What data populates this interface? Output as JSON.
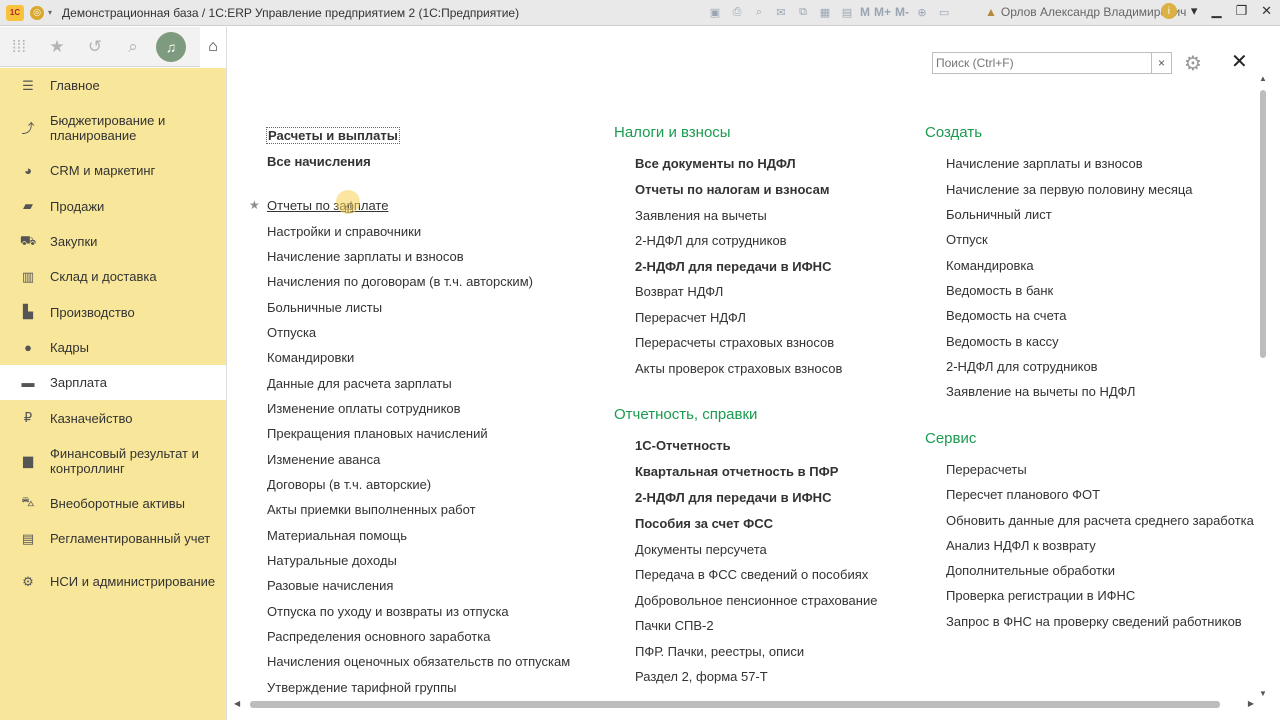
{
  "window": {
    "title": "Демонстрационная база / 1С:ERP Управление предприятием 2  (1С:Предприятие)",
    "app_logo": "1С",
    "user_name": "Орлов Александр Владимирович",
    "toolbar_icons": [
      "save-icon",
      "print-icon",
      "find-icon",
      "mail-icon",
      "link-icon",
      "calendar-icon"
    ],
    "m_label": "M",
    "m_plus_label": "M+",
    "m_minus_label": "M-"
  },
  "quickbar": {
    "icons": [
      "apps-grid-icon",
      "favorites-star-icon",
      "history-icon",
      "search-icon",
      "notifications-bell-icon",
      "home-icon"
    ]
  },
  "sidebar": {
    "items": [
      {
        "label": "Главное",
        "icon": "menu-icon"
      },
      {
        "label": "Бюджетирование и планирование",
        "icon": "chart-icon"
      },
      {
        "label": "CRM и маркетинг",
        "icon": "pie-icon"
      },
      {
        "label": "Продажи",
        "icon": "bag-icon"
      },
      {
        "label": "Закупки",
        "icon": "cart-icon"
      },
      {
        "label": "Склад и доставка",
        "icon": "warehouse-icon"
      },
      {
        "label": "Производство",
        "icon": "factory-icon"
      },
      {
        "label": "Кадры",
        "icon": "person-icon"
      },
      {
        "label": "Зарплата",
        "icon": "card-icon"
      },
      {
        "label": "Казначейство",
        "icon": "ruble-icon"
      },
      {
        "label": "Финансовый результат и контроллинг",
        "icon": "bars-icon"
      },
      {
        "label": "Внеоборотные активы",
        "icon": "truck-icon"
      },
      {
        "label": "Регламентированный учет",
        "icon": "ledger-icon"
      },
      {
        "label": "НСИ и администрирование",
        "icon": "gear-icon"
      }
    ],
    "active_index": 8
  },
  "search": {
    "placeholder": "Поиск (Ctrl+F)",
    "clear": "×"
  },
  "col1": {
    "top_links": [
      "Расчеты и выплаты",
      "Все начисления"
    ],
    "links": [
      "Отчеты по зарплате",
      "Настройки и справочники",
      "Начисление зарплаты и взносов",
      "Начисления по договорам (в т.ч. авторским)",
      "Больничные листы",
      "Отпуска",
      "Командировки",
      "Данные для расчета зарплаты",
      "Изменение оплаты сотрудников",
      "Прекращения плановых начислений",
      "Изменение аванса",
      "Договоры (в т.ч. авторские)",
      "Акты приемки выполненных работ",
      "Материальная помощь",
      "Натуральные доходы",
      "Разовые начисления",
      "Отпуска по уходу и возвраты из отпуска",
      "Распределения основного заработка",
      "Начисления оценочных обязательств по отпускам",
      "Утверждение тарифной группы"
    ]
  },
  "col2": {
    "section1_title": "Налоги и взносы",
    "section1_links": [
      {
        "label": "Все документы по НДФЛ",
        "bold": true
      },
      {
        "label": "Отчеты по налогам и взносам",
        "bold": true
      },
      {
        "label": "Заявления на вычеты",
        "bold": false
      },
      {
        "label": "2-НДФЛ для сотрудников",
        "bold": false
      },
      {
        "label": "2-НДФЛ для передачи в ИФНС",
        "bold": true
      },
      {
        "label": "Возврат НДФЛ",
        "bold": false
      },
      {
        "label": "Перерасчет НДФЛ",
        "bold": false
      },
      {
        "label": "Перерасчеты страховых взносов",
        "bold": false
      },
      {
        "label": "Акты проверок страховых взносов",
        "bold": false
      }
    ],
    "section2_title": "Отчетность, справки",
    "section2_links": [
      {
        "label": "1С-Отчетность",
        "bold": true
      },
      {
        "label": "Квартальная отчетность в ПФР",
        "bold": true
      },
      {
        "label": "2-НДФЛ для передачи в ИФНС",
        "bold": true
      },
      {
        "label": "Пособия за счет ФСС",
        "bold": true
      },
      {
        "label": "Документы персучета",
        "bold": false
      },
      {
        "label": "Передача в ФСС сведений о пособиях",
        "bold": false
      },
      {
        "label": "Добровольное пенсионное страхование",
        "bold": false
      },
      {
        "label": "Пачки СПВ-2",
        "bold": false
      },
      {
        "label": "ПФР. Пачки, реестры, описи",
        "bold": false
      },
      {
        "label": "Раздел 2, форма 57-Т",
        "bold": false
      }
    ]
  },
  "col3": {
    "section1_title": "Создать",
    "section1_links": [
      "Начисление зарплаты и взносов",
      "Начисление за первую половину месяца",
      "Больничный лист",
      "Отпуск",
      "Командировка",
      "Ведомость в банк",
      "Ведомость на счета",
      "Ведомость в кассу",
      "2-НДФЛ для сотрудников",
      "Заявление на вычеты по НДФЛ"
    ],
    "section2_title": "Сервис",
    "section2_links": [
      "Перерасчеты",
      "Пересчет планового ФОТ",
      "Обновить данные для расчета среднего заработка",
      "Анализ НДФЛ к возврату",
      "Дополнительные обработки",
      "Проверка регистрации в ИФНС",
      "Запрос в ФНС на проверку сведений работников"
    ]
  },
  "colors": {
    "sidebar_bg": "#f8e79a",
    "section_title": "#1a9b4f"
  }
}
